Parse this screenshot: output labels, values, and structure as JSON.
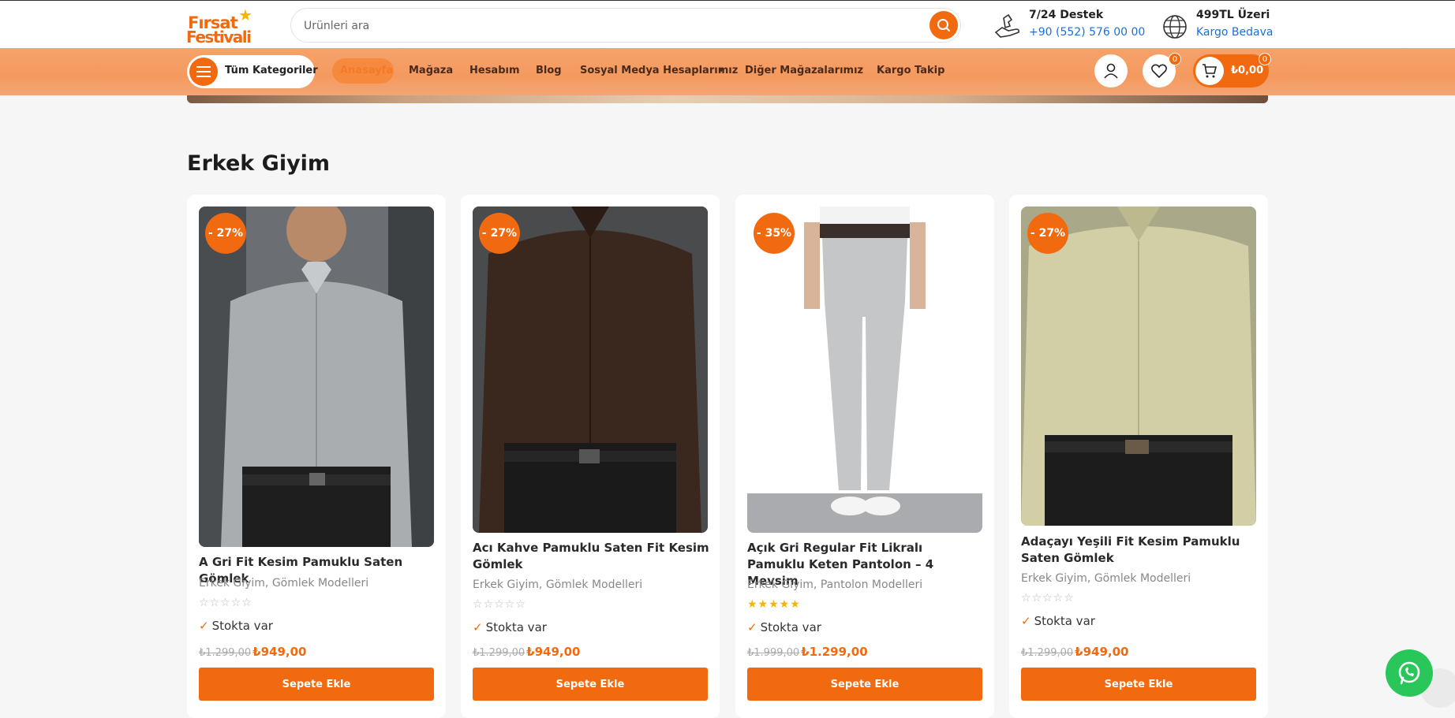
{
  "header": {
    "logo_line1": "Fırsat",
    "logo_line2": "Festivali",
    "search_placeholder": "Ürünleri ara",
    "support_title": "7/24 Destek",
    "support_phone": "+90 (552) 576 00 00",
    "cargo_title": "499TL Üzeri",
    "cargo_sub": "Kargo Bedava"
  },
  "nav": {
    "all_categories": "Tüm Kategoriler",
    "home": "Anasayfa",
    "items": [
      "Mağaza",
      "Hesabım",
      "Blog",
      "Sosyal Medya Hesaplarımız",
      "Diğer Mağazalarımız",
      "Kargo Takip"
    ],
    "wishlist_count": "0",
    "cart_count": "0",
    "cart_total": "₺0,00"
  },
  "section": {
    "title": "Erkek Giyim"
  },
  "products": [
    {
      "discount": "- 27%",
      "name": "A Gri Fit Kesim Pamuklu Saten Gömlek",
      "categories": "Erkek Giyim, Gömlek Modelleri",
      "rating": 0,
      "stock": "Stokta var",
      "old_price": "₺1.299,00",
      "price": "₺949,00",
      "button": "Sepete Ekle"
    },
    {
      "discount": "- 27%",
      "name": "Acı Kahve Pamuklu Saten Fit Kesim Gömlek",
      "categories": "Erkek Giyim, Gömlek Modelleri",
      "rating": 0,
      "stock": "Stokta var",
      "old_price": "₺1.299,00",
      "price": "₺949,00",
      "button": "Sepete Ekle"
    },
    {
      "discount": "- 35%",
      "name": "Açık Gri Regular Fit Likralı Pamuklu Keten Pantolon – 4 Mevsim",
      "categories": "Erkek Giyim, Pantolon Modelleri",
      "rating": 5,
      "stock": "Stokta var",
      "old_price": "₺1.999,00",
      "price": "₺1.299,00",
      "button": "Sepete Ekle"
    },
    {
      "discount": "- 27%",
      "name": "Adaçayı Yeşili Fit Kesim Pamuklu Saten Gömlek",
      "categories": "Erkek Giyim, Gömlek Modelleri",
      "rating": 0,
      "stock": "Stokta var",
      "old_price": "₺1.299,00",
      "price": "₺949,00",
      "button": "Sepete Ekle"
    }
  ],
  "icons": {
    "search": "search-icon",
    "support": "phone-hand-icon",
    "cargo": "globe-icon",
    "menu": "hamburger-icon",
    "user": "user-icon",
    "wishlist": "heart-icon",
    "cart": "cart-icon",
    "whatsapp": "whatsapp-icon"
  },
  "colors": {
    "accent": "#f26a10",
    "nav_bg": "#f49a5f",
    "link": "#1f6fd1",
    "whatsapp": "#29c65a"
  }
}
